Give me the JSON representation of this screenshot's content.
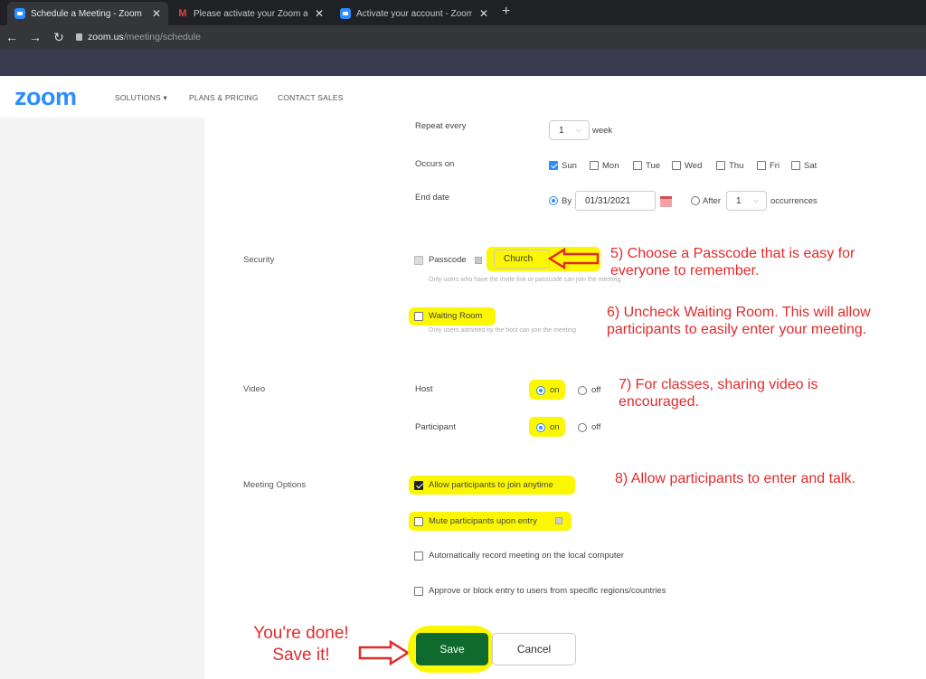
{
  "browser": {
    "tabs": [
      {
        "title": "Schedule a Meeting - Zoom",
        "icon": "zoom-icon"
      },
      {
        "title": "Please activate your Zoom accou",
        "icon": "gmail-icon"
      },
      {
        "title": "Activate your account - Zoom",
        "icon": "zoom-icon"
      }
    ],
    "close_glyph": "✕",
    "new_tab_glyph": "+",
    "url_domain": "zoom.us",
    "url_path": "/meeting/schedule"
  },
  "header": {
    "logo": "zoom",
    "nav": [
      "SOLUTIONS ▾",
      "PLANS & PRICING",
      "CONTACT SALES"
    ]
  },
  "recurrence": {
    "repeat_every_label": "Repeat every",
    "repeat_value": "1",
    "repeat_unit": "week",
    "occurs_on_label": "Occurs on",
    "days": [
      {
        "label": "Sun",
        "checked": true
      },
      {
        "label": "Mon",
        "checked": false
      },
      {
        "label": "Tue",
        "checked": false
      },
      {
        "label": "Wed",
        "checked": false
      },
      {
        "label": "Thu",
        "checked": false
      },
      {
        "label": "Fri",
        "checked": false
      },
      {
        "label": "Sat",
        "checked": false
      }
    ],
    "end_date_label": "End date",
    "by_label": "By",
    "end_date_value": "01/31/2021",
    "after_label": "After",
    "after_value": "1",
    "occurrences_label": "occurrences"
  },
  "security": {
    "label": "Security",
    "passcode_label": "Passcode",
    "passcode_value": "Church",
    "passcode_hint": "Only users who have the invite link or passcode can join the meeting",
    "waiting_room_label": "Waiting Room",
    "waiting_room_hint": "Only users admitted by the host can join the meeting"
  },
  "video": {
    "label": "Video",
    "host_label": "Host",
    "participant_label": "Participant",
    "on_label": "on",
    "off_label": "off"
  },
  "meeting_options": {
    "label": "Meeting Options",
    "options": [
      "Allow participants to join anytime",
      "Mute participants upon entry",
      "Automatically record meeting on the local computer",
      "Approve or block entry to users from specific regions/countries"
    ]
  },
  "buttons": {
    "save": "Save",
    "cancel": "Cancel"
  },
  "annotations": {
    "step5": [
      "5) Choose a Passcode that is easy for",
      "everyone to remember."
    ],
    "step6": [
      "6) Uncheck Waiting Room.  This will allow",
      "participants to easily enter your meeting."
    ],
    "step7": [
      "7) For classes, sharing video is",
      "encouraged."
    ],
    "step8": "8) Allow participants to enter and talk.",
    "done": [
      "You're done!",
      "Save it!"
    ]
  },
  "colors": {
    "accent": "#2d8cff",
    "annotation": "#e02b2b",
    "highlight": "#fbf700",
    "save_green": "#0e6b2d"
  }
}
